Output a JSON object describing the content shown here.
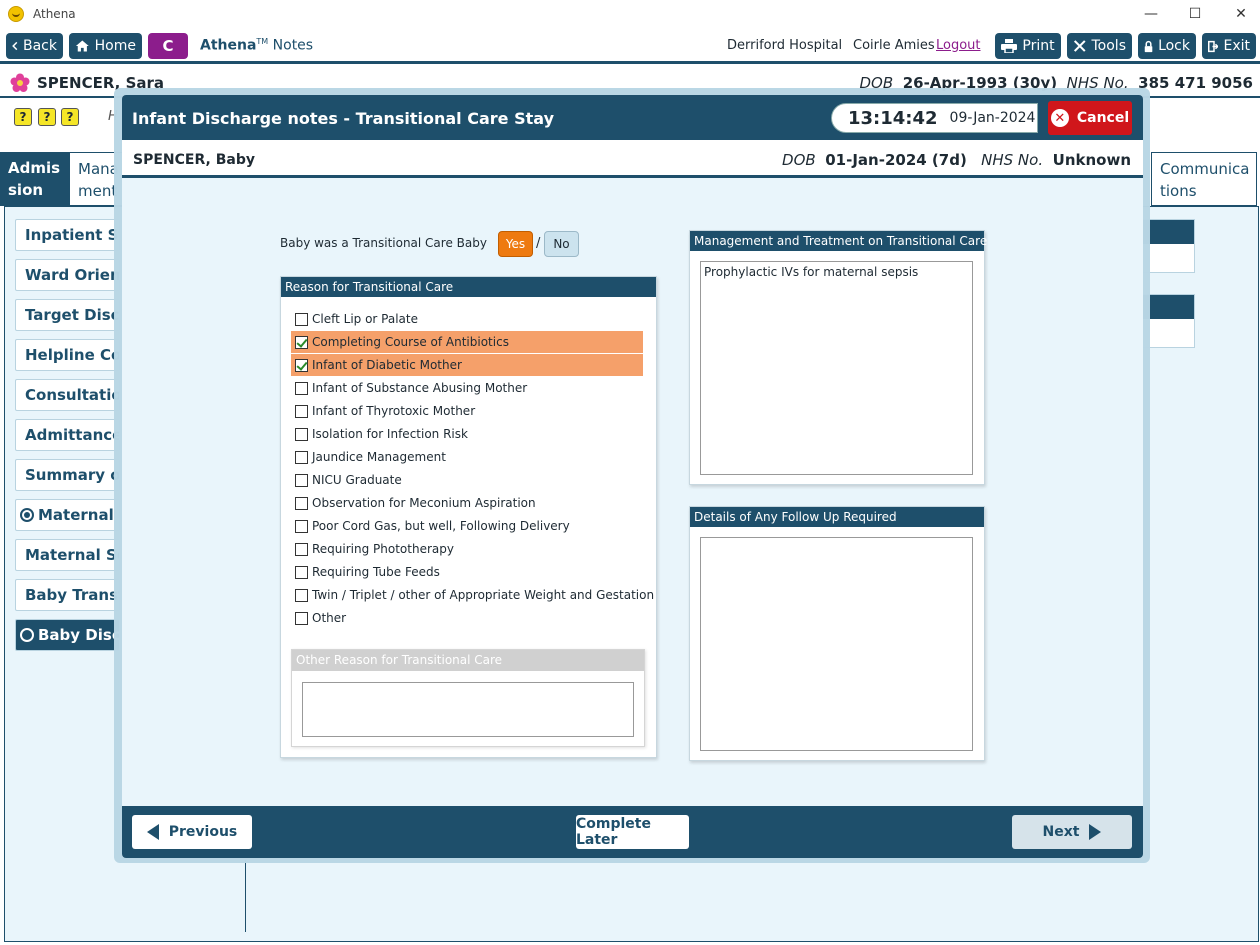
{
  "window": {
    "title": "Athena",
    "minimize": "—",
    "maximize": "☐",
    "close": "✕"
  },
  "toolbar": {
    "back_label": "Back",
    "home_label": "Home",
    "c_label": "C",
    "brand_name": "Athena",
    "brand_tm": "TM",
    "brand_module": "Notes",
    "hospital": "Derriford Hospital",
    "user": "Coirle Amies",
    "logout_label": "Logout",
    "print_label": "Print",
    "tools_label": "Tools",
    "lock_label": "Lock",
    "exit_label": "Exit"
  },
  "patient": {
    "name": "SPENCER, Sara",
    "dob_label": "DOB",
    "dob": "26-Apr-1993 (30y)",
    "nhs_label": "NHS No.",
    "nhs": "385 471 9056"
  },
  "background": {
    "help_icons": [
      "?",
      "?",
      "?"
    ],
    "h_text": "H",
    "tabs": [
      {
        "label_line1": "Admis",
        "label_line2": "sion"
      },
      {
        "label_line1": "Mana",
        "label_line2": "ment"
      },
      {
        "label_line1": "Communica",
        "label_line2": "tions"
      }
    ],
    "sidebar_items": [
      "Inpatient Stay",
      "Ward Orientat",
      "Target Dischar",
      "Helpline Cont",
      "Consultation I",
      "Admittance N",
      "Summary of P",
      "Maternal Di",
      "Maternal Self",
      "Baby Transfer",
      "Baby Discha"
    ]
  },
  "modal": {
    "title": "Infant Discharge notes - Transitional Care Stay",
    "time": "13:14:42",
    "date": "09-Jan-2024",
    "cancel_label": "Cancel",
    "baby": {
      "name": "SPENCER, Baby",
      "dob_label": "DOB",
      "dob": "01-Jan-2024 (7d)",
      "nhs_label": "NHS No.",
      "nhs": "Unknown"
    },
    "question": "Baby was a Transitional Care Baby",
    "yes_label": "Yes",
    "slash": "/",
    "no_label": "No",
    "reason_panel_title": "Reason for Transitional Care",
    "reasons": [
      {
        "label": "Cleft Lip or Palate",
        "checked": false
      },
      {
        "label": "Completing Course of Antibiotics",
        "checked": true
      },
      {
        "label": "Infant of Diabetic Mother",
        "checked": true
      },
      {
        "label": "Infant of Substance Abusing Mother",
        "checked": false
      },
      {
        "label": "Infant of Thyrotoxic Mother",
        "checked": false
      },
      {
        "label": "Isolation for Infection Risk",
        "checked": false
      },
      {
        "label": "Jaundice Management",
        "checked": false
      },
      {
        "label": "NICU Graduate",
        "checked": false
      },
      {
        "label": "Observation for Meconium Aspiration",
        "checked": false
      },
      {
        "label": "Poor Cord Gas, but well, Following Delivery",
        "checked": false
      },
      {
        "label": "Requiring Phototherapy",
        "checked": false
      },
      {
        "label": "Requiring Tube Feeds",
        "checked": false
      },
      {
        "label": "Twin / Triplet / other of Appropriate Weight and Gestation",
        "checked": false
      },
      {
        "label": "Other",
        "checked": false
      }
    ],
    "other_reason_title": "Other Reason for Transitional Care",
    "other_reason_value": "",
    "management_title": "Management and Treatment on Transitional Care",
    "management_value": "Prophylactic IVs for maternal sepsis",
    "followup_title": "Details of Any Follow Up Required",
    "followup_value": "",
    "previous_label": "Previous",
    "complete_later_label": "Complete Later",
    "next_label": "Next"
  },
  "colors": {
    "primary": "#1e4f6b",
    "accent_purple": "#8c1d8c",
    "yes_orange": "#ee7a10",
    "checked_row": "#f5a06a",
    "cancel_red": "#d0161b"
  }
}
